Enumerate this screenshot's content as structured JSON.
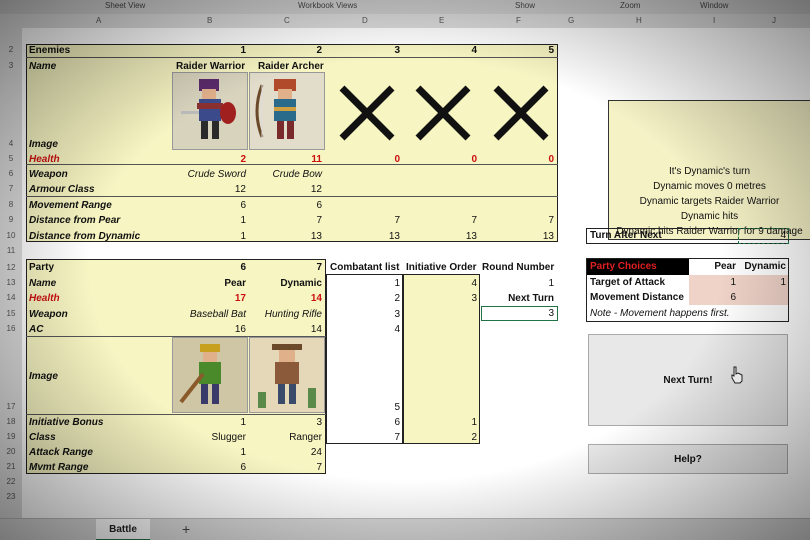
{
  "colors": {
    "accent_red": "#cc1010",
    "yellow": "#f7f5c2",
    "excel_green": "#217346",
    "party_header": "#000000"
  },
  "ribbon": {
    "labels": [
      "Sheet View",
      "Workbook Views",
      "Show",
      "Zoom",
      "Window"
    ]
  },
  "column_headers": [
    "A",
    "B",
    "C",
    "D",
    "E",
    "F",
    "G",
    "H",
    "I",
    "J"
  ],
  "row_numbers": [
    "2",
    "3",
    "4",
    "5",
    "6",
    "7",
    "8",
    "9",
    "10",
    "11",
    "12",
    "13",
    "14",
    "15",
    "16",
    "17",
    "18",
    "19",
    "20",
    "21",
    "22",
    "23"
  ],
  "enemies": {
    "header": "Enemies",
    "cols": [
      "1",
      "2",
      "3",
      "4",
      "5"
    ],
    "rows": {
      "name": {
        "label": "Name",
        "values": [
          "Raider Warrior",
          "Raider Archer",
          "",
          "",
          ""
        ]
      },
      "image": {
        "label": "Image"
      },
      "health": {
        "label": "Health",
        "values": [
          "2",
          "11",
          "0",
          "0",
          "0"
        ]
      },
      "weapon": {
        "label": "Weapon",
        "values": [
          "Crude Sword",
          "Crude Bow"
        ]
      },
      "armour": {
        "label": "Armour Class",
        "values": [
          "12",
          "12"
        ]
      },
      "movement": {
        "label": "Movement Range",
        "values": [
          "6",
          "6"
        ]
      },
      "dist_pear": {
        "label": "Distance from Pear",
        "values": [
          "1",
          "7",
          "7",
          "7",
          "7"
        ]
      },
      "dist_dynamic": {
        "label": "Distance from Dynamic",
        "values": [
          "1",
          "13",
          "13",
          "13",
          "13"
        ]
      }
    }
  },
  "party": {
    "header": "Party",
    "cols": [
      "6",
      "7"
    ],
    "rows": {
      "name": {
        "label": "Name",
        "values": [
          "Pear",
          "Dynamic"
        ]
      },
      "health": {
        "label": "Health",
        "values": [
          "17",
          "14"
        ]
      },
      "weapon": {
        "label": "Weapon",
        "values": [
          "Baseball Bat",
          "Hunting Rifle"
        ]
      },
      "ac": {
        "label": "AC",
        "values": [
          "16",
          "14"
        ]
      },
      "image": {
        "label": "Image"
      },
      "init_bonus": {
        "label": "Initiative Bonus",
        "values": [
          "1",
          "3"
        ]
      },
      "class": {
        "label": "Class",
        "values": [
          "Slugger",
          "Ranger"
        ]
      },
      "attack": {
        "label": "Attack Range",
        "values": [
          "1",
          "24"
        ]
      },
      "mvmt": {
        "label": "Mvmt Range",
        "values": [
          "6",
          "7"
        ]
      }
    }
  },
  "combat": {
    "headers": {
      "list": "Combatant list",
      "initiative": "Initiative Order",
      "round": "Round Number"
    },
    "list": [
      "1",
      "2",
      "3",
      "4",
      "5",
      "6",
      "7"
    ],
    "initiative": [
      "4",
      "3",
      "",
      "",
      "",
      "1",
      "2"
    ],
    "round": "1",
    "next_turn_label": "Next Turn",
    "next_turn_value": "3"
  },
  "status": {
    "lines": [
      "It's Dynamic's turn",
      "Dynamic moves 0 metres",
      "Dynamic targets Raider Warrior",
      "Dynamic hits",
      "Dynamic hits Raider Warrior for 9 damage"
    ]
  },
  "turn_after_next": {
    "label": "Turn After Next",
    "value": "4"
  },
  "party_choices": {
    "header": "Party Choices",
    "cols": [
      "Pear",
      "Dynamic"
    ],
    "target": {
      "label": "Target of Attack",
      "values": [
        "1",
        "1"
      ]
    },
    "movement": {
      "label": "Movement Distance",
      "values": [
        "6",
        ""
      ]
    },
    "note": "Note - Movement happens first."
  },
  "buttons": {
    "next_turn": "Next Turn!",
    "help": "Help?"
  },
  "sheet_tab": "Battle",
  "add_sheet": "+"
}
